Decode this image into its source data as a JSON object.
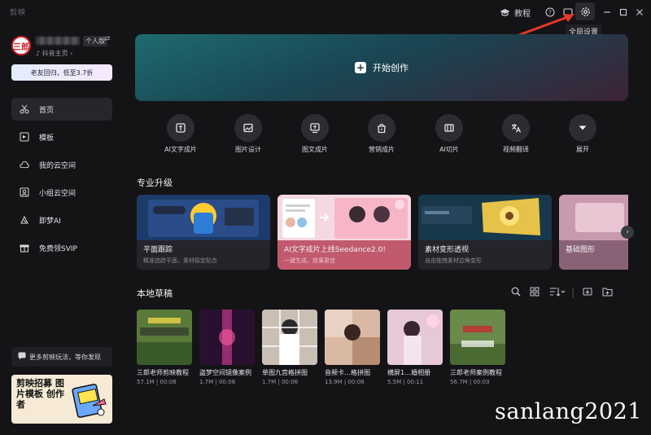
{
  "titlebar": {
    "app_name": "剪映",
    "tutorial_label": "教程",
    "tooltip": "全局设置"
  },
  "user": {
    "avatar_text": "三郎",
    "tag": "个人版",
    "link": "抖音主页 ›",
    "promo": "老友回归，低至3.7折"
  },
  "nav": [
    {
      "label": "首页",
      "icon": "scissors-icon"
    },
    {
      "label": "模板",
      "icon": "template-icon"
    },
    {
      "label": "我的云空间",
      "icon": "cloud-icon"
    },
    {
      "label": "小组云空间",
      "icon": "group-cloud-icon"
    },
    {
      "label": "即梦AI",
      "icon": "ai-icon"
    },
    {
      "label": "免费领SVIP",
      "icon": "gift-icon"
    }
  ],
  "feedback": "更多剪映玩法，等你发现",
  "ad": {
    "title": "剪映招募 图片模板 创作者"
  },
  "hero": {
    "label": "开始创作"
  },
  "tools": [
    {
      "label": "AI文字成片",
      "icon": "ai-text-video-icon"
    },
    {
      "label": "图片设计",
      "icon": "image-design-icon"
    },
    {
      "label": "图文成片",
      "icon": "text-image-video-icon"
    },
    {
      "label": "营销成片",
      "icon": "marketing-video-icon"
    },
    {
      "label": "AI切片",
      "icon": "ai-clip-icon"
    },
    {
      "label": "视频翻译",
      "icon": "translate-icon"
    },
    {
      "label": "展开",
      "icon": "expand-icon"
    }
  ],
  "upgrade": {
    "title": "专业升级",
    "cards": [
      {
        "title": "平面跟踪",
        "subtitle": "精准追踪平面，素材稳定贴合"
      },
      {
        "title": "AI文字成片上线Seedance2.0!",
        "subtitle": "一键生成，效果更佳"
      },
      {
        "title": "素材变形透视",
        "subtitle": "自由拖拽素材边角变形"
      },
      {
        "title": "基础图形",
        "subtitle": ""
      }
    ]
  },
  "drafts": {
    "title": "本地草稿",
    "items": [
      {
        "name": "三郎老师剪映教程",
        "meta": "57.1M | 00:08"
      },
      {
        "name": "盗梦空间镜像案例",
        "meta": "1.7M | 00:08"
      },
      {
        "name": "单图九宫格拼图",
        "meta": "1.7M | 00:06"
      },
      {
        "name": "音频卡…格拼图",
        "meta": "13.9M | 00:08"
      },
      {
        "name": "横屏1…婚相册",
        "meta": "5.5M | 00:11"
      },
      {
        "name": "三郎老师案例教程",
        "meta": "56.7M | 00:03"
      }
    ]
  },
  "watermark": "sanlang2021"
}
